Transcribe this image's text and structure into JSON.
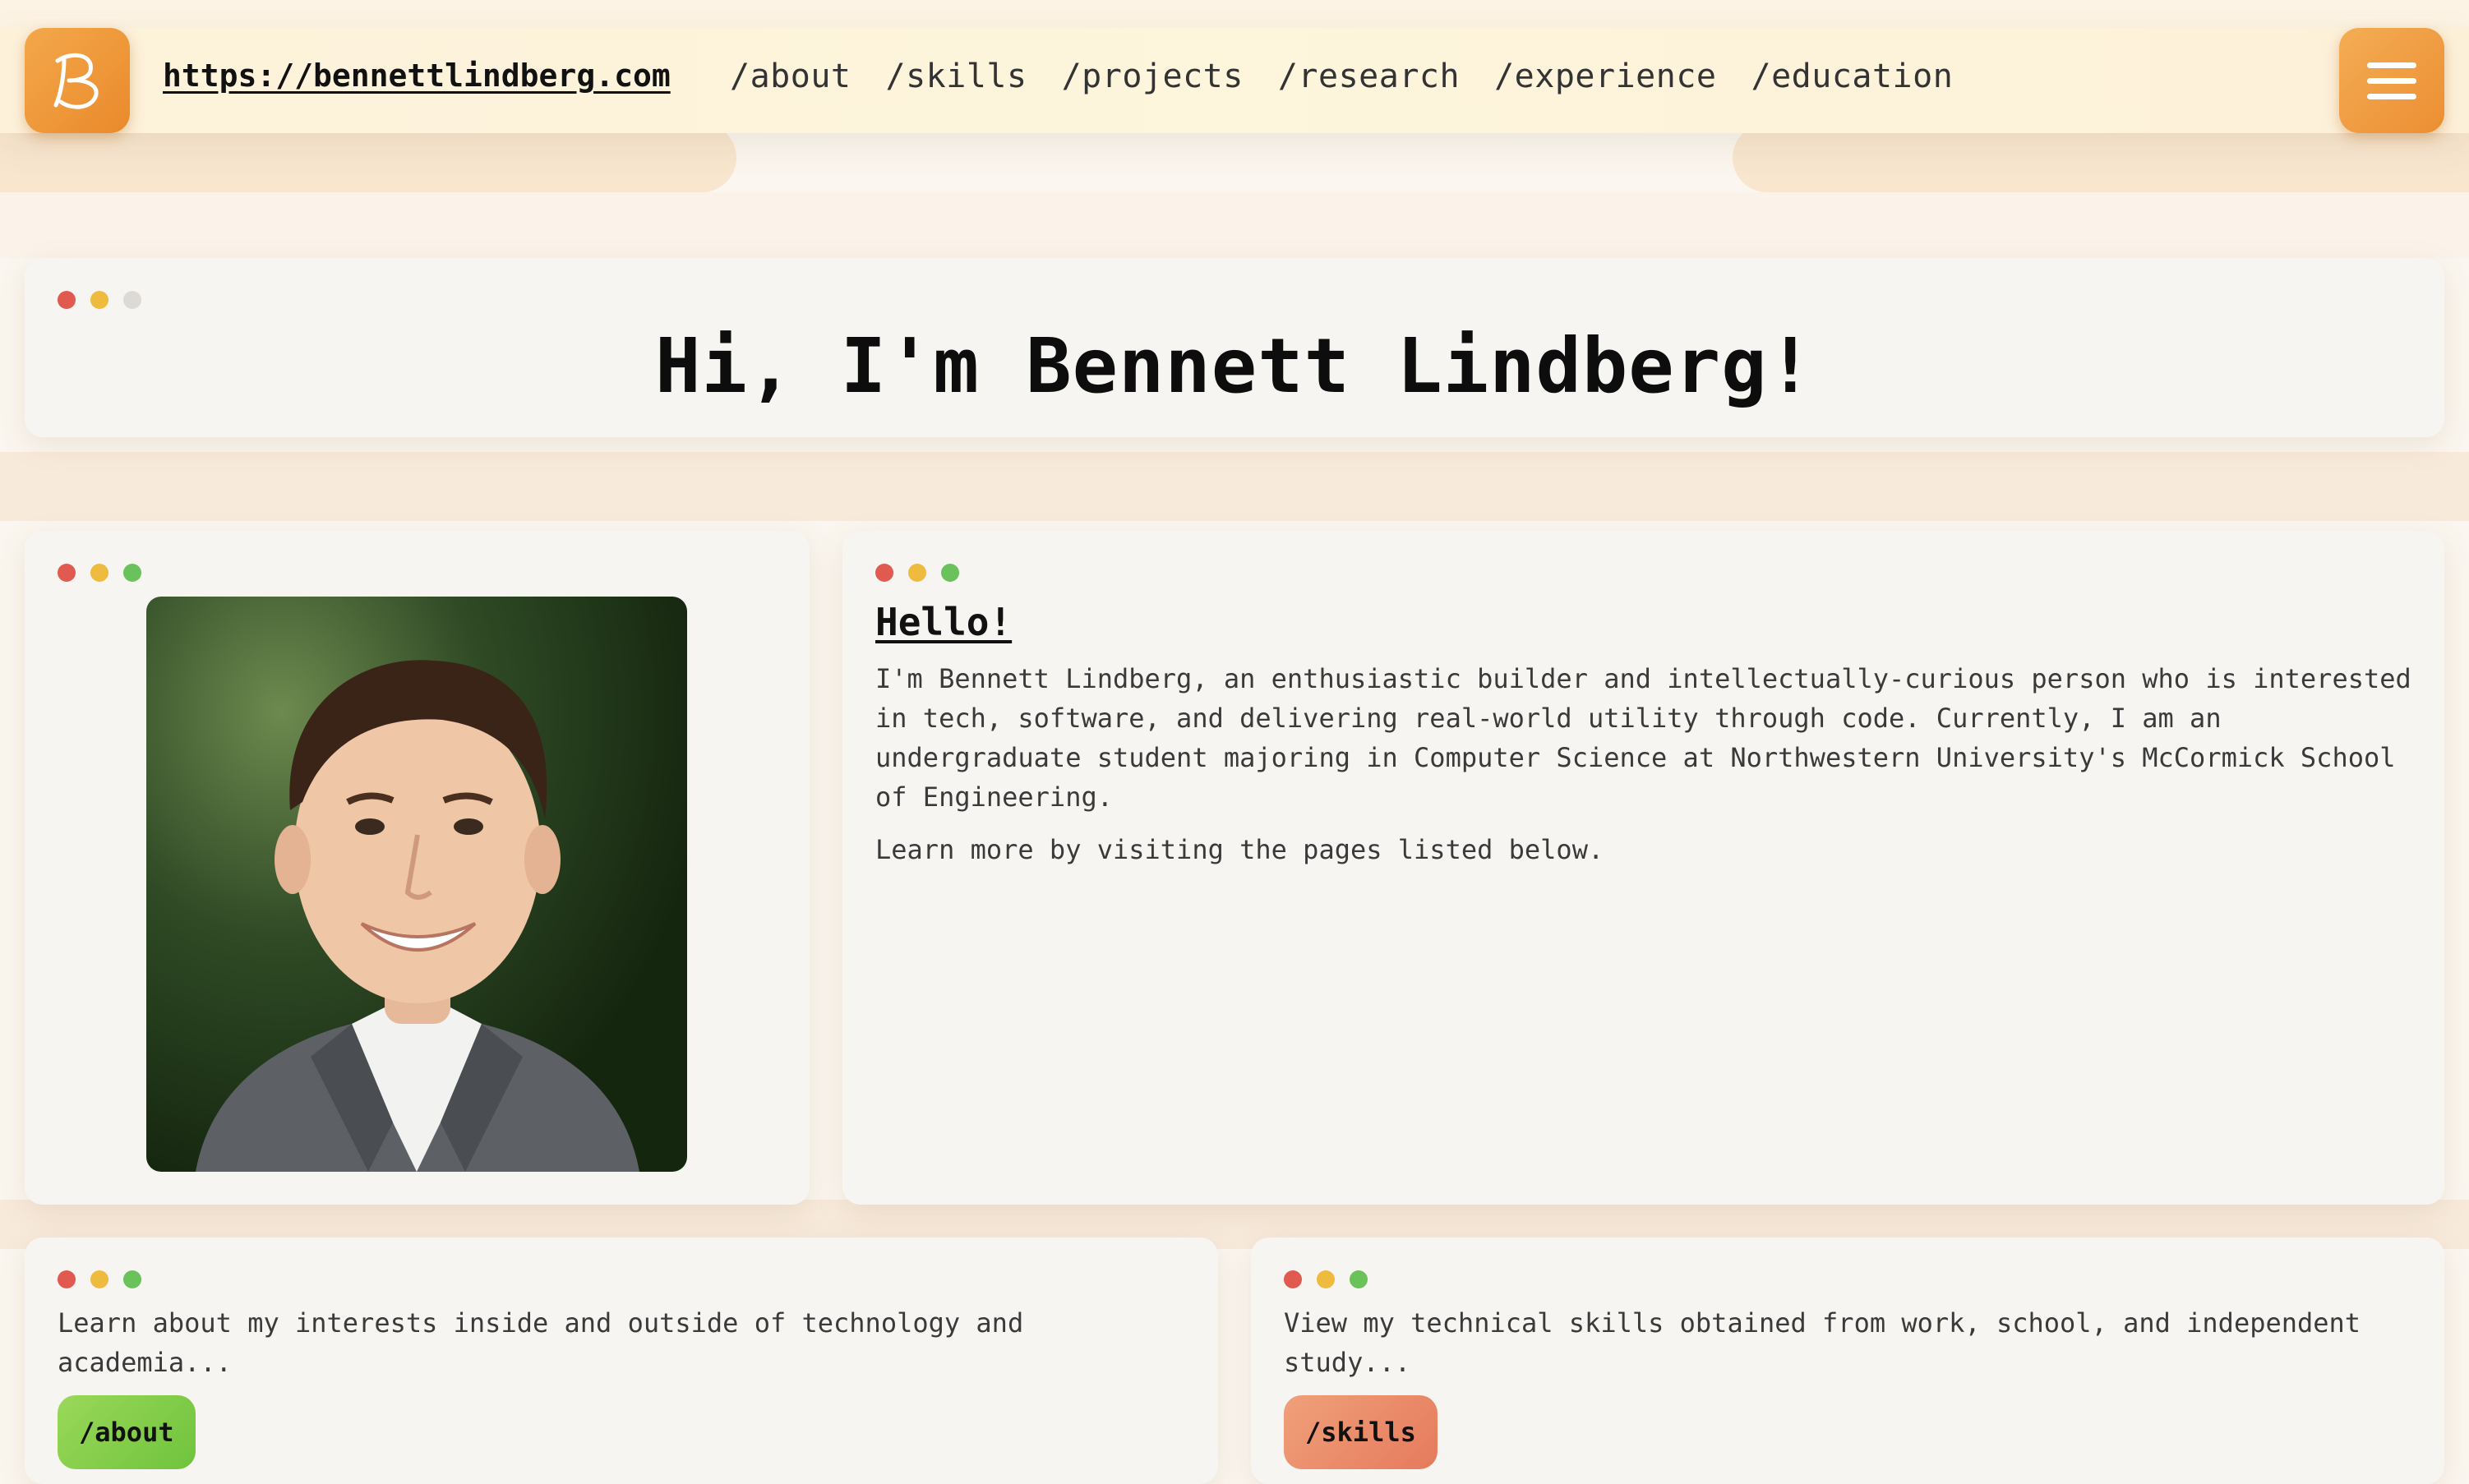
{
  "nav": {
    "url": "https://bennettlindberg.com",
    "links": [
      "/about",
      "/skills",
      "/projects",
      "/research",
      "/experience",
      "/education"
    ],
    "logo_icon": "b-monogram-icon",
    "menu_icon": "hamburger-menu-icon"
  },
  "hero": {
    "title": "Hi, I'm Bennett Lindberg!"
  },
  "intro": {
    "heading": "Hello!",
    "paragraph1": "I'm Bennett Lindberg, an enthusiastic builder and intellectually-curious person who is interested in tech, software, and delivering real-world utility through code. Currently, I am an undergraduate student majoring in Computer Science at Northwestern University's McCormick School of Engineering.",
    "paragraph2": "Learn more by visiting the pages listed below."
  },
  "cards": {
    "about": {
      "text": "Learn about my interests inside and outside of technology and academia...",
      "button": "/about"
    },
    "skills": {
      "text": "View my technical skills obtained from work, school, and independent study...",
      "button": "/skills"
    }
  },
  "colors": {
    "accent_orange": "#ec8e32",
    "dot_red": "#e05a4f",
    "dot_yellow": "#eebb3f",
    "dot_green": "#69c25a"
  }
}
